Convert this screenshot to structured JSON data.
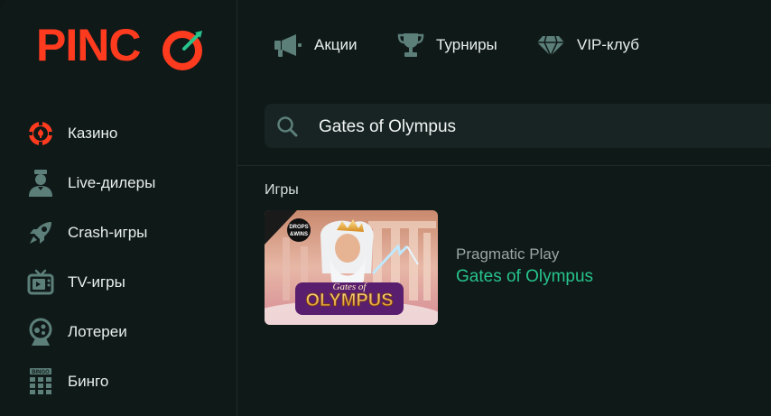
{
  "brand": {
    "logo_text": "PINCO"
  },
  "topnav": [
    {
      "label": "Акции",
      "icon": "megaphone-icon"
    },
    {
      "label": "Турниры",
      "icon": "trophy-icon"
    },
    {
      "label": "VIP-клуб",
      "icon": "diamond-icon"
    }
  ],
  "sidebar": {
    "items": [
      {
        "label": "Казино",
        "icon": "casino-chip-icon",
        "active": true
      },
      {
        "label": "Live-дилеры",
        "icon": "dealer-icon"
      },
      {
        "label": "Crash-игры",
        "icon": "rocket-icon"
      },
      {
        "label": "TV-игры",
        "icon": "tv-icon"
      },
      {
        "label": "Лотереи",
        "icon": "lottery-icon"
      },
      {
        "label": "Бинго",
        "icon": "bingo-icon"
      }
    ]
  },
  "search": {
    "value": "Gates of Olympus"
  },
  "results": {
    "section_title": "Игры",
    "games": [
      {
        "provider": "Pragmatic Play",
        "title": "Gates of Olympus",
        "thumb_badge_line1": "DROPS",
        "thumb_badge_line2": "&WINS",
        "thumb_logo_line1": "Gates of",
        "thumb_logo_line2": "OLYMPUS"
      }
    ]
  },
  "colors": {
    "accent_red": "#ff3b1f",
    "accent_green": "#27c48c",
    "background": "#0f1918",
    "icon_teal": "#5c7f79"
  }
}
